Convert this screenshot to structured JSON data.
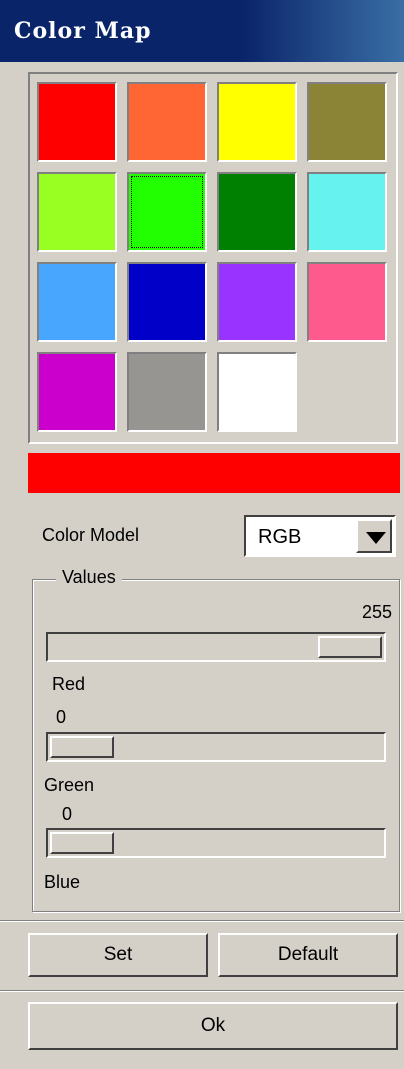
{
  "window": {
    "title": "Color Map"
  },
  "palette": {
    "swatches": [
      "#ff0000",
      "#ff6633",
      "#ffff00",
      "#8b8436",
      "#99ff22",
      "#22ff00",
      "#008000",
      "#66f3f0",
      "#48a6ff",
      "#0000c8",
      "#9933ff",
      "#ff5a8e",
      "#cc00cc",
      "#979592",
      "#ffffff"
    ],
    "selected_index": 5
  },
  "preview": {
    "color": "#ff0000"
  },
  "color_model": {
    "label": "Color Model",
    "value": "RGB"
  },
  "values": {
    "title": "Values",
    "channels": [
      {
        "name": "Red",
        "value": "255",
        "level": 1.0
      },
      {
        "name": "Green",
        "value": "0",
        "level": 0.0
      },
      {
        "name": "Blue",
        "value": "0",
        "level": 0.0
      }
    ]
  },
  "buttons": {
    "set": "Set",
    "default": "Default",
    "ok": "Ok"
  }
}
